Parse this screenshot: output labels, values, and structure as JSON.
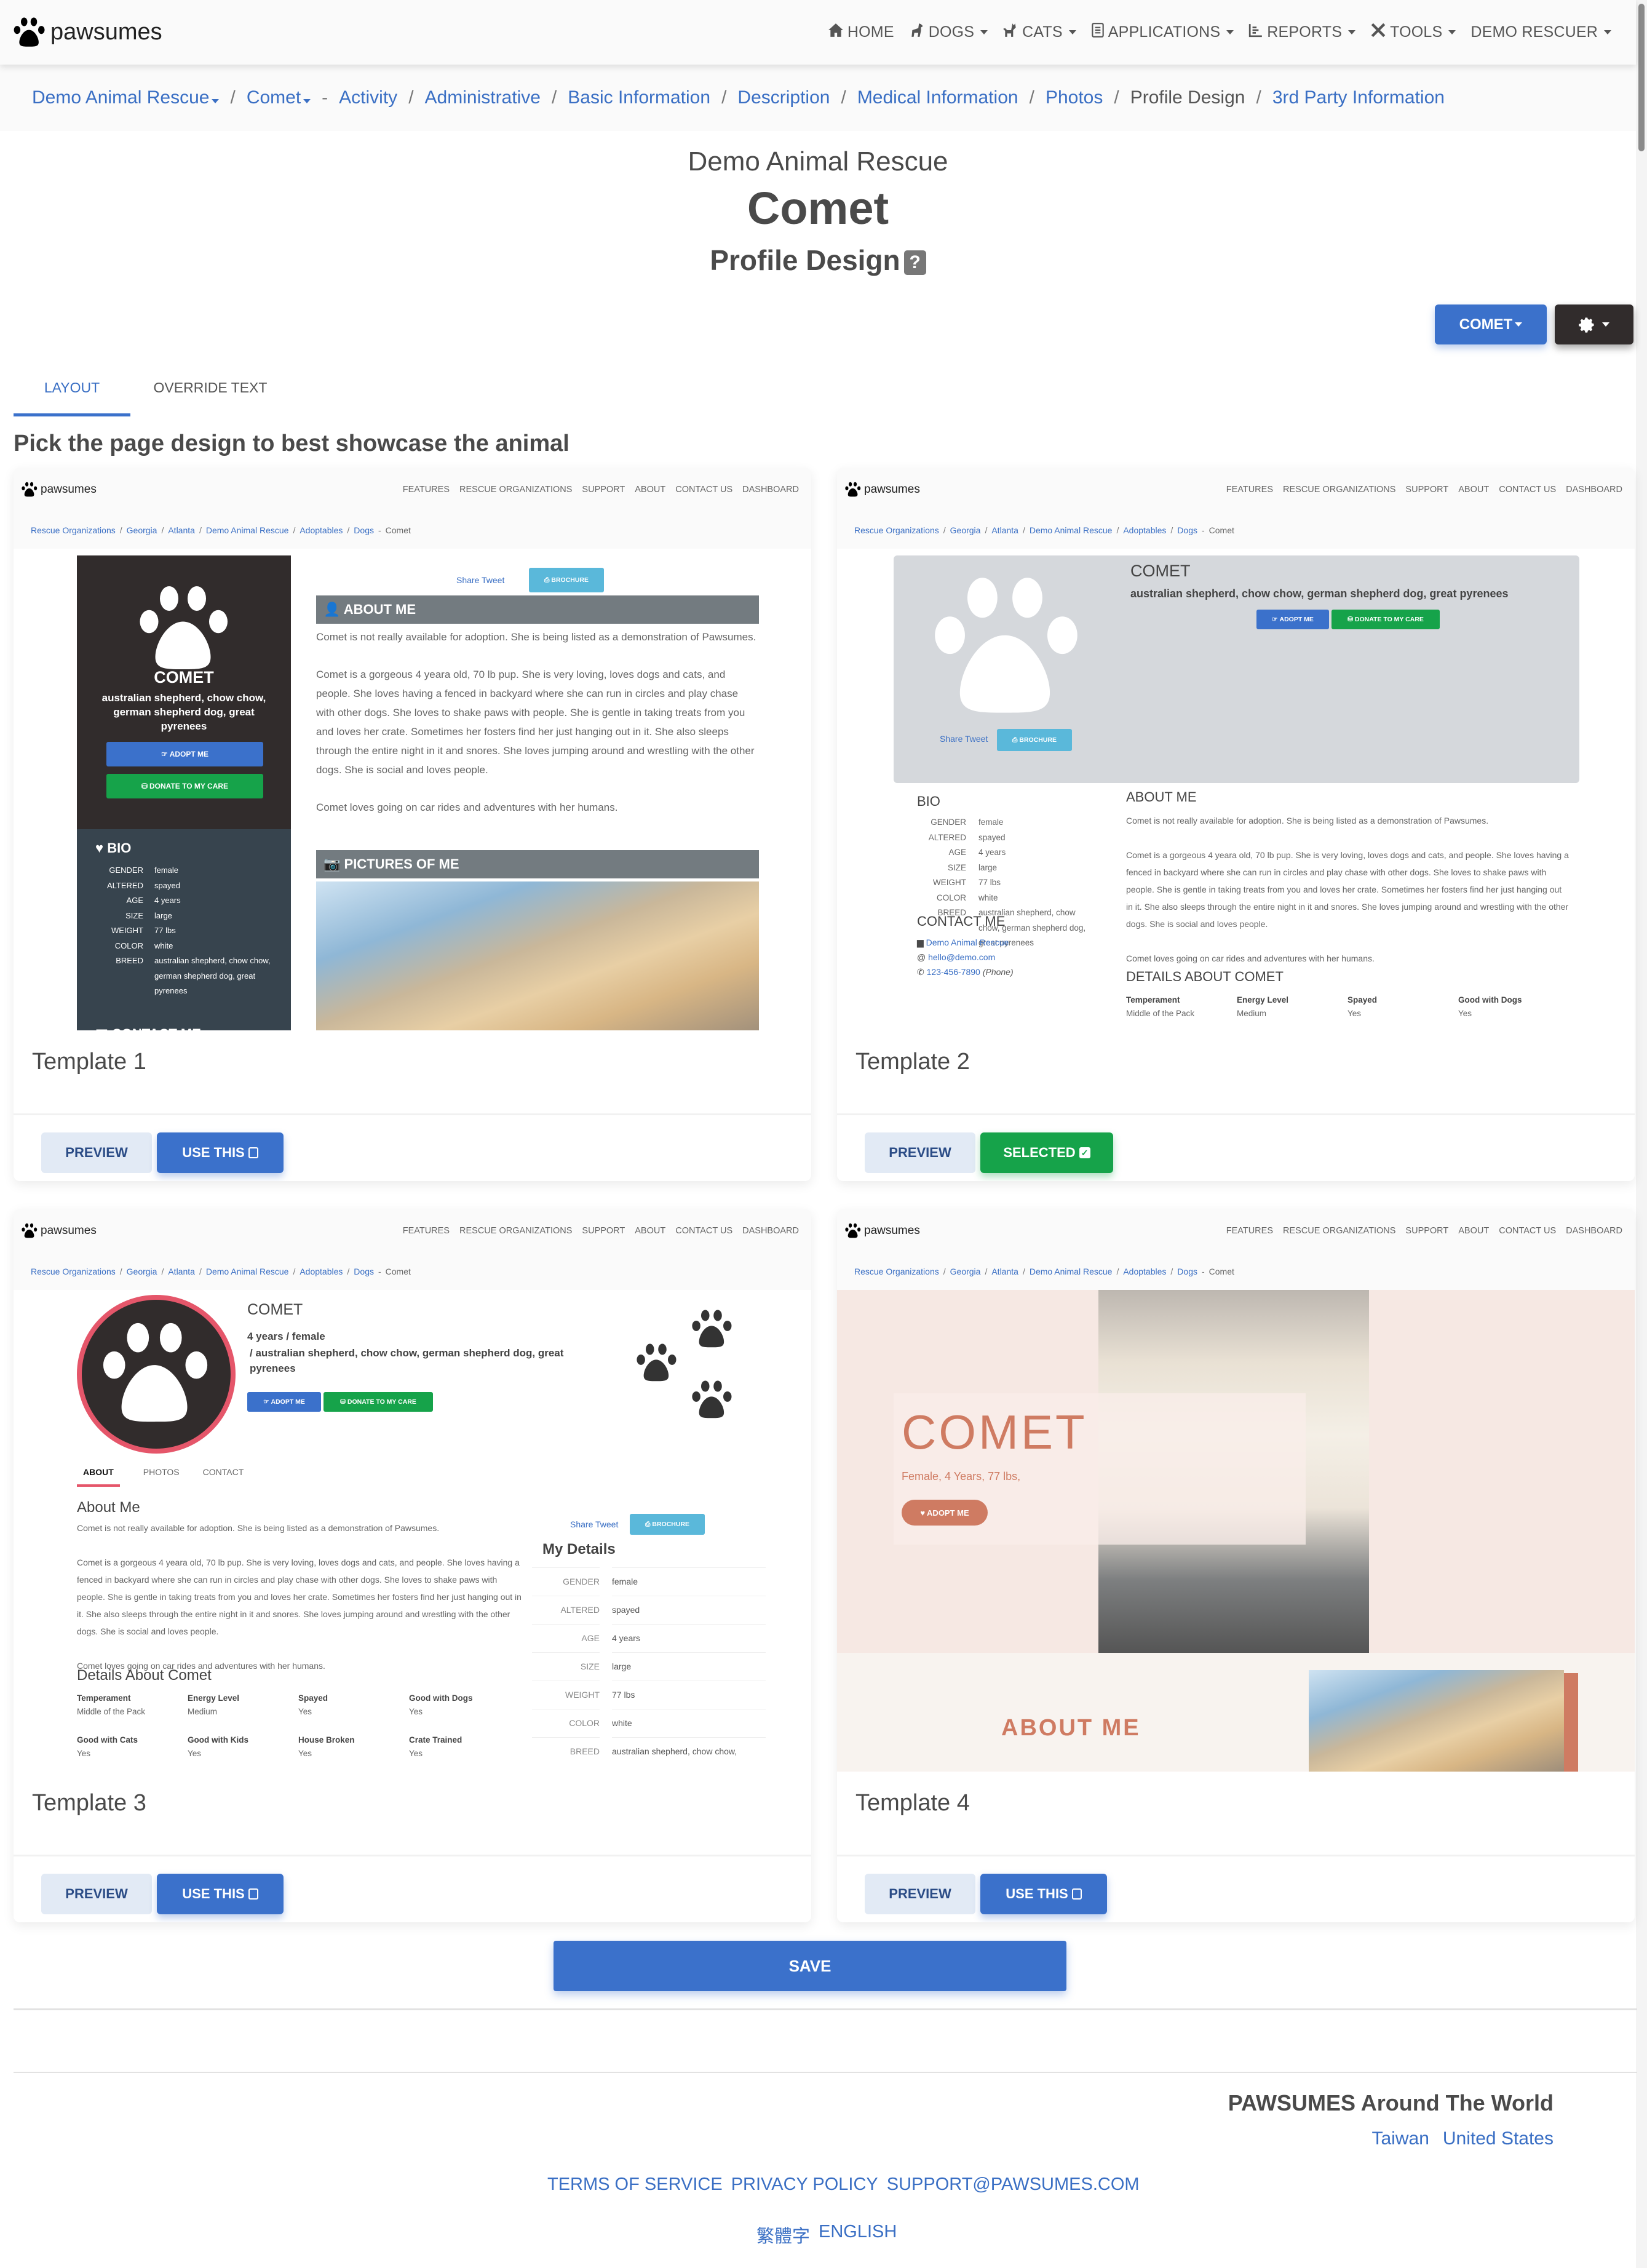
{
  "app": {
    "brand": "pawsumes"
  },
  "topnav": {
    "items": [
      {
        "label": "HOME",
        "icon": "home-icon",
        "dropdown": false
      },
      {
        "label": "DOGS",
        "icon": "dog-icon",
        "dropdown": true
      },
      {
        "label": "CATS",
        "icon": "cat-icon",
        "dropdown": true
      },
      {
        "label": "APPLICATIONS",
        "icon": "clipboard-icon",
        "dropdown": true
      },
      {
        "label": "REPORTS",
        "icon": "chart-icon",
        "dropdown": true
      },
      {
        "label": "TOOLS",
        "icon": "tools-icon",
        "dropdown": true
      },
      {
        "label": "DEMO RESCUER",
        "icon": "",
        "dropdown": true
      }
    ]
  },
  "breadcrumb": {
    "org": "Demo Animal Rescue",
    "animal": "Comet",
    "items": [
      "Activity",
      "Administrative",
      "Basic Information",
      "Description",
      "Medical Information",
      "Photos",
      "Profile Design",
      "3rd Party Information"
    ],
    "current": "Profile Design"
  },
  "header": {
    "org": "Demo Animal Rescue",
    "animal": "Comet",
    "page": "Profile Design",
    "help": "?"
  },
  "actions": {
    "animal_button": "COMET",
    "gear_icon": "gear-icon"
  },
  "tabs": [
    {
      "label": "LAYOUT",
      "active": true
    },
    {
      "label": "OVERRIDE TEXT",
      "active": false
    }
  ],
  "prompt": "Pick the page design to best showcase the animal",
  "preview_site": {
    "brand": "pawsumes",
    "links": [
      "FEATURES",
      "RESCUE ORGANIZATIONS",
      "SUPPORT",
      "ABOUT",
      "CONTACT US",
      "DASHBOARD"
    ],
    "crumbs": [
      "Rescue Organizations",
      "Georgia",
      "Atlanta",
      "Demo Animal Rescue",
      "Adoptables",
      "Dogs"
    ],
    "crumb_current": "Comet"
  },
  "animal": {
    "name": "COMET",
    "breed": "australian shepherd, chow chow, german shepherd dog, great pyrenees",
    "age_gender": "4 years / female",
    "breed_line": "/ australian shepherd, chow chow, german shepherd dog, great pyrenees",
    "summary": "Female, 4 Years, 77 lbs,",
    "adopt": "ADOPT ME",
    "donate": "DONATE TO MY CARE",
    "share": "Share Tweet",
    "brochure": "BROCHURE",
    "about_title": "ABOUT ME",
    "about_title_mixed": "About Me",
    "pictures_title": "PICTURES OF ME",
    "bio_title": "BIO",
    "contact_title": "CONTACT ME",
    "my_details": "My Details",
    "details_title_upper": "DETAILS ABOUT COMET",
    "details_title": "Details About Comet",
    "about_p1": "Comet is not really available for adoption. She is being listed as a demonstration of Pawsumes.",
    "about_p2": "Comet is a gorgeous 4 yeara old, 70 lb pup. She is very loving, loves dogs and cats, and people. She loves having a fenced in backyard where she can run in circles and play chase with other dogs. She loves to shake paws with people. She is gentle in taking treats from you and loves her crate. Sometimes her fosters find her just hanging out in it. She also sleeps through the entire night in it and snores. She loves jumping around and wrestling with the other dogs. She is social and loves people.",
    "about_p3": "Comet loves going on car rides and adventures with her humans.",
    "bio": [
      {
        "k": "GENDER",
        "v": "female"
      },
      {
        "k": "ALTERED",
        "v": "spayed"
      },
      {
        "k": "AGE",
        "v": "4 years"
      },
      {
        "k": "SIZE",
        "v": "large"
      },
      {
        "k": "WEIGHT",
        "v": "77 lbs"
      },
      {
        "k": "COLOR",
        "v": "white"
      },
      {
        "k": "BREED",
        "v": "australian shepherd, chow chow, german shepherd dog, great pyrenees"
      }
    ],
    "contact": {
      "org": "Demo Animal Rescue",
      "email": "hello@demo.com",
      "phone": "123-456-7890",
      "phone_label": "(Phone)"
    },
    "details": [
      {
        "k": "Temperament",
        "v": "Middle of the Pack"
      },
      {
        "k": "Energy Level",
        "v": "Medium"
      },
      {
        "k": "Spayed",
        "v": "Yes"
      },
      {
        "k": "Good with Dogs",
        "v": "Yes"
      },
      {
        "k": "Good with Cats",
        "v": "Yes"
      },
      {
        "k": "Good with Kids",
        "v": "Yes"
      },
      {
        "k": "House Broken",
        "v": "Yes"
      },
      {
        "k": "Crate Trained",
        "v": "Yes"
      }
    ],
    "t3_tabs": [
      "ABOUT",
      "PHOTOS",
      "CONTACT"
    ]
  },
  "templates": [
    {
      "title": "Template 1",
      "preview": "PREVIEW",
      "action": "USE THIS",
      "selected": false
    },
    {
      "title": "Template 2",
      "preview": "PREVIEW",
      "action": "SELECTED",
      "selected": true
    },
    {
      "title": "Template 3",
      "preview": "PREVIEW",
      "action": "USE THIS",
      "selected": false
    },
    {
      "title": "Template 4",
      "preview": "PREVIEW",
      "action": "USE THIS",
      "selected": false
    }
  ],
  "save": "SAVE",
  "footer": {
    "world_title": "PAWSUMES Around The World",
    "countries": [
      "Taiwan",
      "United States"
    ],
    "links": [
      "TERMS OF SERVICE",
      "PRIVACY POLICY",
      "SUPPORT@PAWSUMES.COM"
    ],
    "languages": [
      "繁體字",
      "ENGLISH"
    ]
  },
  "colors": {
    "primary": "#3b71cb",
    "success": "#16a34a",
    "dark": "#312c2c",
    "info": "#5ab8da",
    "t4_accent": "#cf7b62",
    "t3_ring": "#e5566a"
  }
}
